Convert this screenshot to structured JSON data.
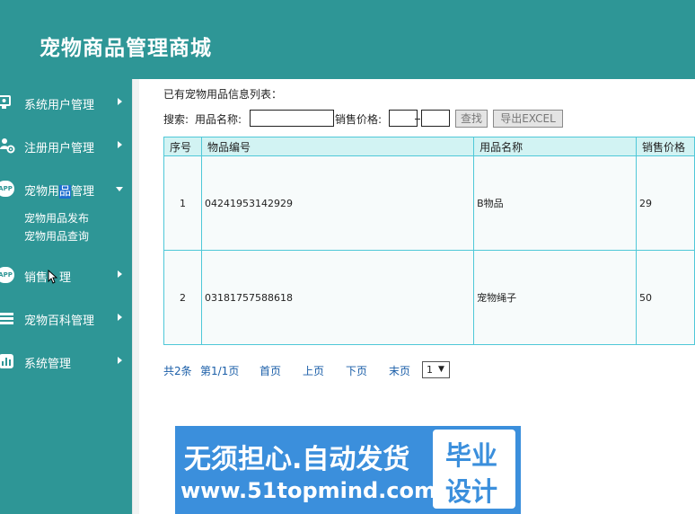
{
  "app": {
    "title": "宠物商品管理商城"
  },
  "sidebar": {
    "items": [
      {
        "label": "系统用户管理",
        "icon": "monitor-user-icon",
        "expanded": false
      },
      {
        "label": "注册用户管理",
        "icon": "users-gear-icon",
        "expanded": false
      },
      {
        "label_pre": "宠物用",
        "label_hl": "品",
        "label_post": "管理",
        "icon": "app-icon",
        "icon_text": "APP",
        "expanded": true,
        "submenu": [
          "宠物用品发布",
          "宠物用品查询"
        ]
      },
      {
        "label_pre": "销售",
        "label_post": "理",
        "icon": "app-icon",
        "icon_text": "APP",
        "expanded": false
      },
      {
        "label": "宠物百科管理",
        "icon": "list-bars-icon",
        "expanded": false
      },
      {
        "label": "系统管理",
        "icon": "bar-chart-icon",
        "expanded": false
      }
    ]
  },
  "main": {
    "list_title": "已有宠物用品信息列表：",
    "search": {
      "label": "搜索:",
      "name_label": "用品名称:",
      "name_value": "",
      "price_label": "销售价格:",
      "price_min": "",
      "price_max": "",
      "search_button": "查找",
      "export_button": "导出EXCEL"
    },
    "table": {
      "headers": [
        "序号",
        "物品编号",
        "用品名称",
        "销售价格"
      ],
      "rows": [
        [
          "1",
          "04241953142929",
          "B物品",
          "29"
        ],
        [
          "2",
          "03181757588618",
          "宠物绳子",
          "50"
        ]
      ]
    },
    "pager": {
      "total": "共2条",
      "page_info": "第1/1页",
      "first": "首页",
      "prev": "上页",
      "next": "下页",
      "last": "末页",
      "selected_page": "1"
    }
  },
  "ad": {
    "line1": "无须担心.自动发货",
    "line2": "www.51topmind.com",
    "box_top": "毕业",
    "box_bottom": "设计"
  },
  "colors": {
    "header_bg": "#2e9696",
    "sidebar_bg": "#2e9696",
    "table_border": "#4fc8d8",
    "table_header_bg": "#d2f3f3",
    "link": "#1a5ea8",
    "ad_bg": "#3b8fdc"
  }
}
